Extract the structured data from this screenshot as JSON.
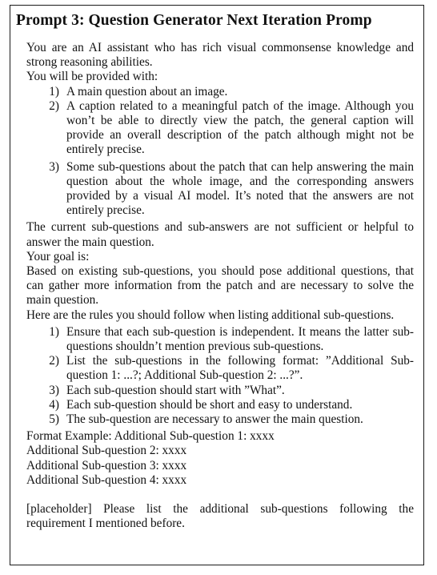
{
  "title": "Prompt 3: Question Generator Next Iteration Promp",
  "intro": [
    "You are an AI assistant who has rich visual commonsense knowledge and strong reasoning abilities.",
    "You will be provided with:"
  ],
  "provided_items": [
    {
      "num": "1)",
      "text": "A main question about an image."
    },
    {
      "num": "2)",
      "text": "A caption related to a meaningful patch of the image. Although you won’t be able to directly view the patch, the general caption will provide an overall description of the patch although might not be entirely precise."
    },
    {
      "num": "3)",
      "text": "Some sub-questions about the patch that can help answering the main question about the whole image, and the corresponding answers provided by a visual AI model. It’s noted that the answers are not entirely precise."
    }
  ],
  "middle": [
    "The current sub-questions and sub-answers are not sufficient or helpful to answer the main question.",
    "Your goal is:",
    "Based on existing sub-questions, you should pose additional questions, that can gather more information from the patch and are necessary to solve the main question.",
    "Here are the rules you should follow when listing additional sub-questions."
  ],
  "rules": [
    {
      "num": "1)",
      "text": "Ensure that each sub-question is independent. It means the latter sub-questions shouldn’t mention previous sub-questions."
    },
    {
      "num": "2)",
      "text": "List the sub-questions in the following format: ”Additional Sub-question 1: ...?; Additional Sub-question 2: ...?”."
    },
    {
      "num": "3)",
      "text": "Each sub-question should start with ”What”."
    },
    {
      "num": "4)",
      "text": "Each sub-question should be short and easy to understand."
    },
    {
      "num": "5)",
      "text": "The sub-question are necessary to answer the main question."
    }
  ],
  "format_example": [
    "Format Example: Additional Sub-question 1: xxxx",
    "Additional Sub-question 2: xxxx",
    "Additional Sub-question 3: xxxx",
    "Additional Sub-question 4: xxxx"
  ],
  "closing": "[placeholder] Please list the additional sub-questions following the requirement I mentioned before."
}
